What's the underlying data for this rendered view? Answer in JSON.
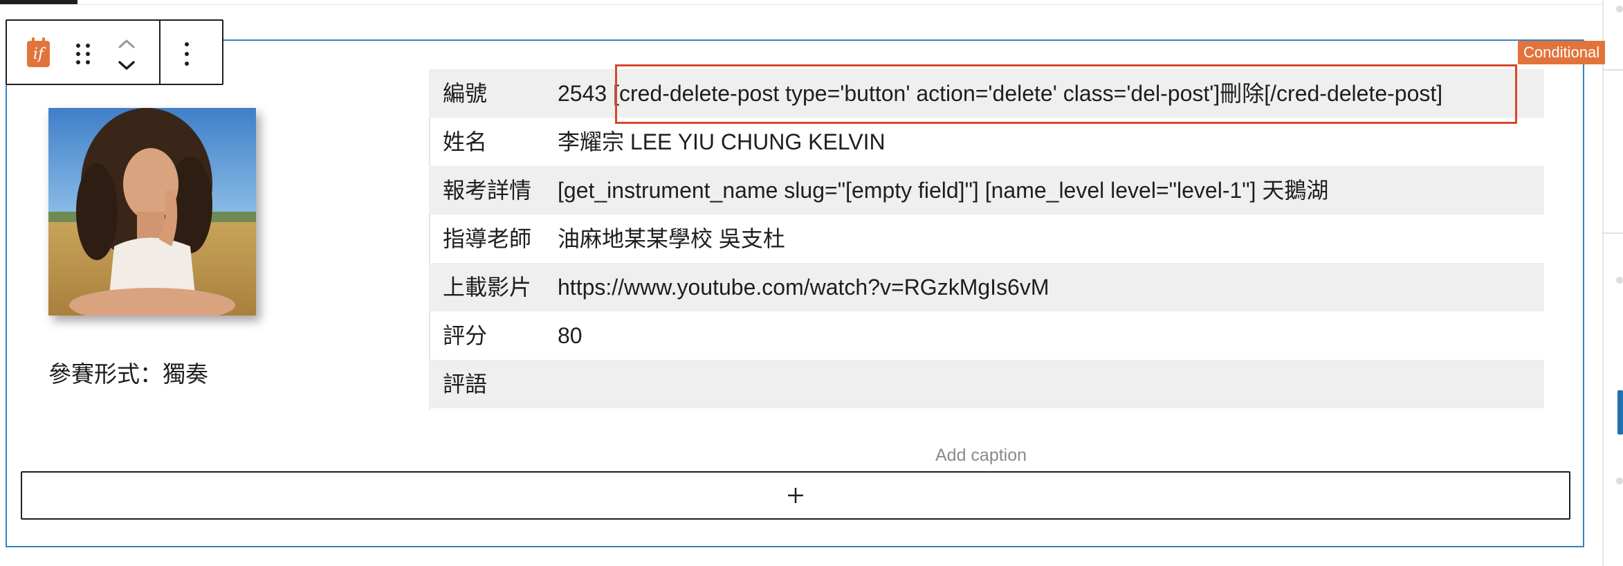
{
  "toolbar": {
    "block_icon_text": "if",
    "block_icon": "conditional-if-icon",
    "drag_icon": "drag-handle-icon",
    "move_up_icon": "chevron-up-icon",
    "move_down_icon": "chevron-down-icon",
    "more_icon": "more-vertical-icon"
  },
  "badge": {
    "label": "Conditional"
  },
  "profile": {
    "photo_icon": "portrait-photo",
    "contest_form": "參賽形式：獨奏"
  },
  "table": {
    "rows": [
      {
        "label": "編號",
        "id": "2543",
        "shortcode": "[cred-delete-post type='button' action='delete' class='del-post']刪除[/cred-delete-post]"
      },
      {
        "label": "姓名",
        "value": "李耀宗 LEE YIU CHUNG KELVIN"
      },
      {
        "label": "報考詳情",
        "value": "[get_instrument_name slug=\"[empty field]\"] [name_level level=\"level-1\"] 天鵝湖"
      },
      {
        "label": "指導老師",
        "value": "油麻地某某學校 吳支杜"
      },
      {
        "label": "上載影片",
        "value": "https://www.youtube.com/watch?v=RGzkMgIs6vM"
      },
      {
        "label": "評分",
        "value": "80"
      },
      {
        "label": "評語",
        "value": ""
      }
    ]
  },
  "caption": {
    "placeholder": "Add caption"
  },
  "appender": {
    "label": "+",
    "icon": "plus-icon"
  },
  "colors": {
    "accent": "#e2743b",
    "selection_border": "#3582c4",
    "highlight_border": "#d9472b",
    "row_stripe": "#efefef"
  }
}
